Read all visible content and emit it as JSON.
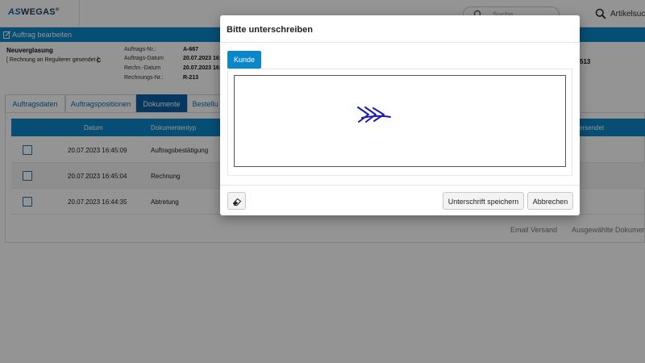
{
  "app": {
    "logo_prefix": "AS",
    "logo_rest": "WEGAS",
    "logo_mark": "®",
    "search_placeholder": "Suche",
    "article_search_label": "Artikelsuche",
    "edit_order_label": "Auftrag bearbeiten"
  },
  "order": {
    "title": "Neuverglasung",
    "status": "[ Rechnung an Regulierer gesendet ]",
    "status_icon": "refresh-icon",
    "fields": [
      {
        "label": "Auftrags-Nr.:",
        "value": "A-667"
      },
      {
        "label": "Auftrags-Datum",
        "value": "20.07.2023 16:"
      },
      {
        "label": "Rechn.-Datum",
        "value": "20.07.2023 16:"
      },
      {
        "label": "Rechnungs-Nr.:",
        "value": "R-213"
      }
    ],
    "right_number": "513"
  },
  "tabs": [
    {
      "label": "Auftragsdaten"
    },
    {
      "label": "Auftragspositionen"
    },
    {
      "label": "Dokumente"
    },
    {
      "label": "Bestellu"
    }
  ],
  "table": {
    "headers": {
      "date": "Datum",
      "type": "Dokumententyp",
      "sent": "versendet"
    },
    "rows": [
      {
        "date": "20.07.2023 16:45:09",
        "type": "Auftragsbestätigung"
      },
      {
        "date": "20.07.2023 16:45:04",
        "type": "Rechnung"
      },
      {
        "date": "20.07.2023 16:44:35",
        "type": "Abtretung"
      }
    ],
    "actions": {
      "email": "Email Versand",
      "selected": "Ausgewählte Dokumen"
    }
  },
  "modal": {
    "title": "Bitte unterschreiben",
    "tab_label": "Kunde",
    "eraser_icon": "eraser-icon",
    "save_label": "Unterschrift speichern",
    "cancel_label": "Abbrechen",
    "signature_color": "#1a1ab8"
  },
  "colors": {
    "primary_blue": "#0b87c9",
    "dark_blue": "#0b5fa5"
  }
}
